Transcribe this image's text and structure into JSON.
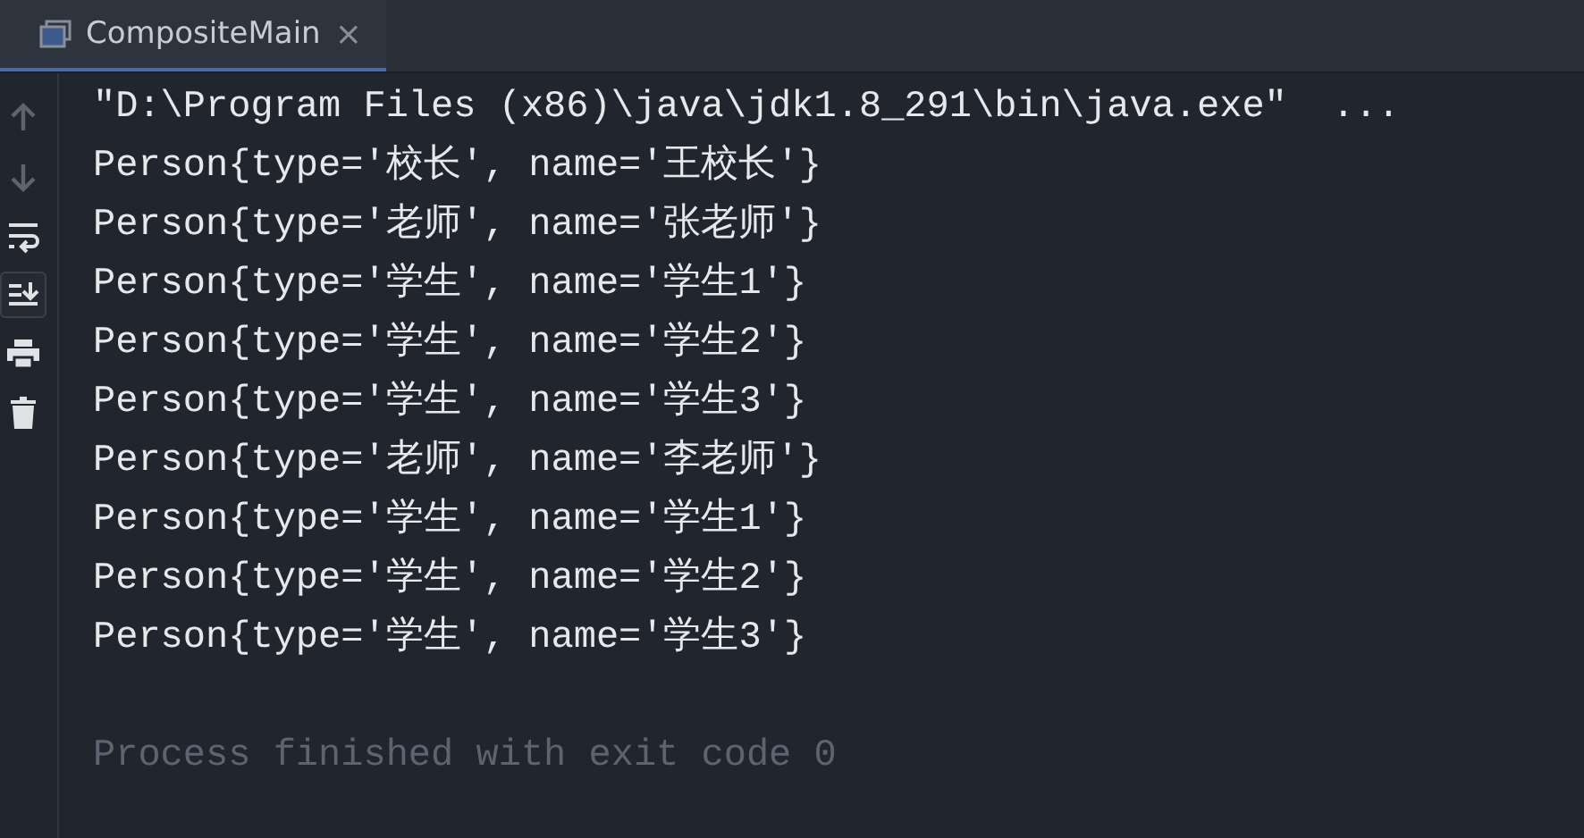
{
  "tab": {
    "title": "CompositeMain",
    "close": "×",
    "selected": true
  },
  "toolbar": [
    {
      "kind": "up",
      "selected": false
    },
    {
      "kind": "down",
      "selected": false
    },
    {
      "kind": "wrap",
      "selected": false
    },
    {
      "kind": "scroll-end",
      "selected": true
    },
    {
      "kind": "print",
      "selected": false
    },
    {
      "kind": "trash",
      "selected": false
    }
  ],
  "console": [
    {
      "kind": "command",
      "text": "\"D:\\Program Files (x86)\\java\\jdk1.8_291\\bin\\java.exe\"  ..."
    },
    {
      "kind": "output",
      "text": "Person{type='校长', name='王校长'}"
    },
    {
      "kind": "output",
      "text": "Person{type='老师', name='张老师'}"
    },
    {
      "kind": "output",
      "text": "Person{type='学生', name='学生1'}"
    },
    {
      "kind": "output",
      "text": "Person{type='学生', name='学生2'}"
    },
    {
      "kind": "output",
      "text": "Person{type='学生', name='学生3'}"
    },
    {
      "kind": "output",
      "text": "Person{type='老师', name='李老师'}"
    },
    {
      "kind": "output",
      "text": "Person{type='学生', name='学生1'}"
    },
    {
      "kind": "output",
      "text": "Person{type='学生', name='学生2'}"
    },
    {
      "kind": "output",
      "text": "Person{type='学生', name='学生3'}"
    },
    {
      "kind": "blank"
    },
    {
      "kind": "exit",
      "text": "Process finished with exit code 0"
    }
  ]
}
